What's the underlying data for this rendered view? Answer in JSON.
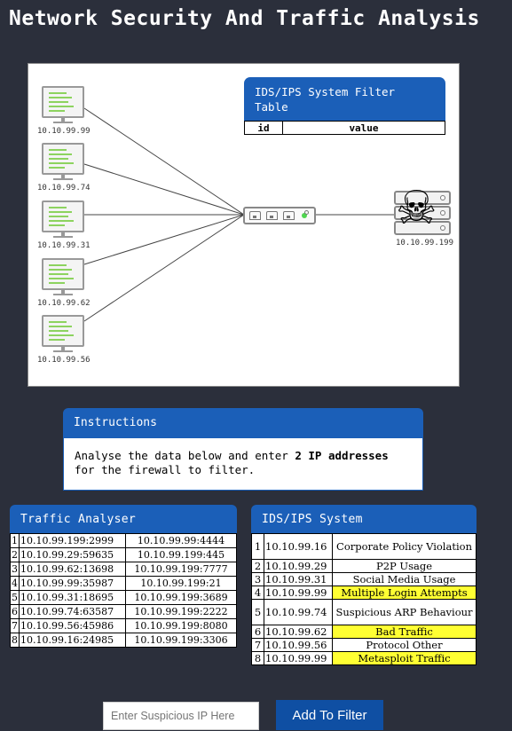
{
  "page": {
    "title": "Network Security And Traffic Analysis"
  },
  "diagram": {
    "hosts": [
      {
        "ip": "10.10.99.99"
      },
      {
        "ip": "10.10.99.74"
      },
      {
        "ip": "10.10.99.31"
      },
      {
        "ip": "10.10.99.62"
      },
      {
        "ip": "10.10.99.56"
      }
    ],
    "server": {
      "ip": "10.10.99.199",
      "icon": "skull-crossbones-icon"
    },
    "filter_table": {
      "title": "IDS/IPS System Filter Table",
      "col_id": "id",
      "col_value": "value"
    }
  },
  "instructions": {
    "title": "Instructions",
    "text_before": "Analyse the data below and enter ",
    "text_bold": "2 IP addresses",
    "text_after": " for the firewall to filter."
  },
  "traffic_analyser": {
    "title": "Traffic Analyser",
    "rows": [
      {
        "n": "1",
        "src": "10.10.99.199:2999",
        "dst": "10.10.99.99:4444"
      },
      {
        "n": "2",
        "src": "10.10.99.29:59635",
        "dst": "10.10.99.199:445"
      },
      {
        "n": "3",
        "src": "10.10.99.62:13698",
        "dst": "10.10.99.199:7777"
      },
      {
        "n": "4",
        "src": "10.10.99.99:35987",
        "dst": "10.10.99.199:21"
      },
      {
        "n": "5",
        "src": "10.10.99.31:18695",
        "dst": "10.10.99.199:3689"
      },
      {
        "n": "6",
        "src": "10.10.99.74:63587",
        "dst": "10.10.99.199:2222"
      },
      {
        "n": "7",
        "src": "10.10.99.56:45986",
        "dst": "10.10.99.199:8080"
      },
      {
        "n": "8",
        "src": "10.10.99.16:24985",
        "dst": "10.10.99.199:3306"
      }
    ]
  },
  "ids_system": {
    "title": "IDS/IPS System",
    "highlight_color": "#ffff33",
    "rows": [
      {
        "n": "1",
        "ip": "10.10.99.16",
        "desc": "Corporate Policy Violation"
      },
      {
        "n": "2",
        "ip": "10.10.99.29",
        "desc": "P2P Usage"
      },
      {
        "n": "3",
        "ip": "10.10.99.31",
        "desc": "Social Media Usage"
      },
      {
        "n": "4",
        "ip": "10.10.99.99",
        "desc": "Multiple Login Attempts"
      },
      {
        "n": "5",
        "ip": "10.10.99.74",
        "desc": "Suspicious ARP Behaviour"
      },
      {
        "n": "6",
        "ip": "10.10.99.62",
        "desc": "Bad Traffic"
      },
      {
        "n": "7",
        "ip": "10.10.99.56",
        "desc": "Protocol Other"
      },
      {
        "n": "8",
        "ip": "10.10.99.99",
        "desc": "Metasploit Traffic"
      }
    ]
  },
  "controls": {
    "ip_placeholder": "Enter Suspicious IP Here",
    "add_button": "Add To Filter"
  }
}
